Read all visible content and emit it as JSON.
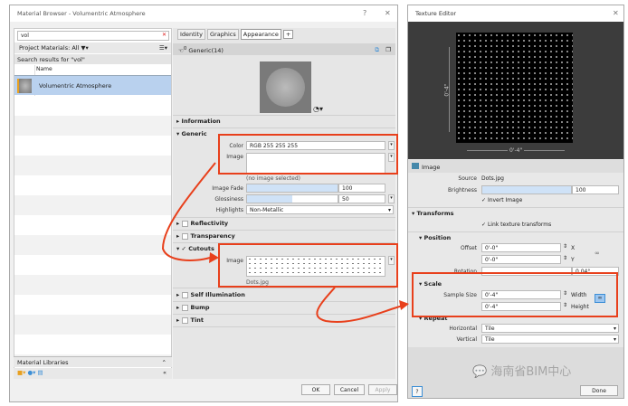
{
  "material_browser": {
    "title": "Material Browser - Volumentric Atmosphere",
    "help": "?",
    "close": "✕",
    "search_value": "vol",
    "filter_label": "Project Materials: All",
    "search_results": "Search results for \"vol\"",
    "column_name": "Name",
    "items": [
      {
        "name": "Volumentric Atmosphere"
      }
    ],
    "libraries_label": "Material Libraries",
    "tabs": [
      "Identity",
      "Graphics",
      "Appearance",
      "+"
    ],
    "asset_count": "0",
    "asset_name": "Generic(14)",
    "sections": {
      "information": "Information",
      "generic": "Generic",
      "reflectivity": "Reflectivity",
      "transparency": "Transparency",
      "cutouts": "Cutouts",
      "self_illumination": "Self Illumination",
      "bump": "Bump",
      "tint": "Tint"
    },
    "generic": {
      "color_label": "Color",
      "color_value": "RGB 255 255 255",
      "image_label": "Image",
      "image_note": "(no image selected)",
      "image_fade_label": "Image Fade",
      "image_fade_value": "100",
      "image_fade_fraction": 1.0,
      "glossiness_label": "Glossiness",
      "glossiness_value": "50",
      "glossiness_fraction": 0.5,
      "highlights_label": "Highlights",
      "highlights_value": "Non-Metallic"
    },
    "cutouts": {
      "image_label": "Image",
      "file": "Dots.jpg"
    },
    "ok": "OK",
    "cancel": "Cancel",
    "apply": "Apply"
  },
  "texture_editor": {
    "title": "Texture Editor",
    "close": "✕",
    "dim_vertical": "0'-4\"",
    "dim_horizontal": "0'-4\"",
    "image_header": "Image",
    "source_label": "Source",
    "source_value": "Dots.jpg",
    "brightness_label": "Brightness",
    "brightness_value": "100",
    "brightness_fraction": 1.0,
    "invert_label": "Invert Image",
    "transforms": "Transforms",
    "link_label": "Link texture transforms",
    "position": "Position",
    "offset_label": "Offset",
    "offset_x": "0'-0\"",
    "offset_y": "0'-0\"",
    "x": "X",
    "y": "Y",
    "rotation_label": "Rotation",
    "rotation_value": "0.04°",
    "scale": "Scale",
    "sample_size_label": "Sample Size",
    "width_value": "0'-4\"",
    "height_value": "0'-4\"",
    "width": "Width",
    "height": "Height",
    "repeat": "Repeat",
    "horizontal_label": "Horizontal",
    "horizontal_value": "Tile",
    "vertical_label": "Vertical",
    "vertical_value": "Tile",
    "help": "?",
    "done": "Done"
  },
  "watermark": "海南省BIM中心",
  "colors": {
    "annotation": "#e8401c",
    "selection": "#b9d1ee",
    "accent": "#3d8fd6"
  }
}
